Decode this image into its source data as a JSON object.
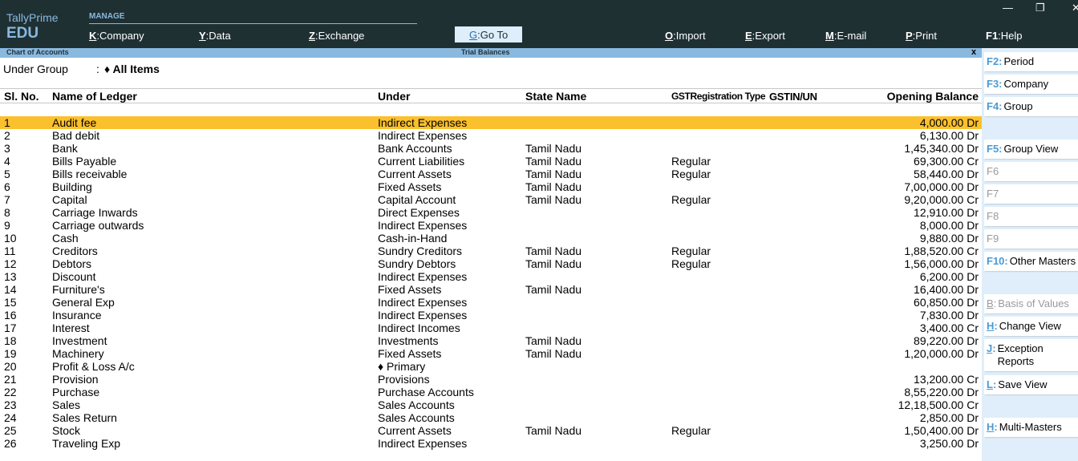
{
  "app": {
    "brand_line1": "TallyPrime",
    "brand_line2": "EDU",
    "section_label": "MANAGE"
  },
  "top_menu": [
    {
      "key": "K",
      "label": "Company"
    },
    {
      "key": "Y",
      "label": "Data"
    },
    {
      "key": "Z",
      "label": "Exchange"
    },
    {
      "key": "G",
      "label": "Go To"
    },
    {
      "key": "O",
      "label": "Import"
    },
    {
      "key": "E",
      "label": "Export"
    },
    {
      "key": "M",
      "label": "E-mail"
    },
    {
      "key": "P",
      "label": "Print"
    },
    {
      "key": "F1",
      "label": "Help"
    }
  ],
  "window_controls": {
    "minimize": "—",
    "restore": "❐",
    "close": "✕"
  },
  "titlebar": {
    "left": "Chart of Accounts",
    "center": "Trial Balances",
    "close": "x"
  },
  "filter": {
    "label": "Under Group",
    "colon": ":",
    "value": "♦ All Items"
  },
  "table": {
    "headers": {
      "sl_no": "Sl. No.",
      "name": "Name of Ledger",
      "under": "Under",
      "state": "State Name",
      "gst_type": "GSTRegistration Type",
      "gstin": "GSTIN/UN",
      "balance": "Opening Balance"
    },
    "rows": [
      {
        "sl": "1",
        "name": "Audit fee",
        "under": "Indirect Expenses",
        "state": "",
        "gst": "",
        "balance": "4,000.00 Dr"
      },
      {
        "sl": "2",
        "name": "Bad debit",
        "under": "Indirect Expenses",
        "state": "",
        "gst": "",
        "balance": "6,130.00 Dr"
      },
      {
        "sl": "3",
        "name": "Bank",
        "under": "Bank Accounts",
        "state": "Tamil Nadu",
        "gst": "",
        "balance": "1,45,340.00 Dr"
      },
      {
        "sl": "4",
        "name": "Bills Payable",
        "under": "Current Liabilities",
        "state": "Tamil Nadu",
        "gst": "Regular",
        "balance": "69,300.00 Cr"
      },
      {
        "sl": "5",
        "name": "Bills receivable",
        "under": "Current Assets",
        "state": "Tamil Nadu",
        "gst": "Regular",
        "balance": "58,440.00 Dr"
      },
      {
        "sl": "6",
        "name": "Building",
        "under": "Fixed Assets",
        "state": "Tamil Nadu",
        "gst": "",
        "balance": "7,00,000.00 Dr"
      },
      {
        "sl": "7",
        "name": "Capital",
        "under": "Capital Account",
        "state": "Tamil Nadu",
        "gst": "Regular",
        "balance": "9,20,000.00 Cr"
      },
      {
        "sl": "8",
        "name": "Carriage Inwards",
        "under": "Direct Expenses",
        "state": "",
        "gst": "",
        "balance": "12,910.00 Dr"
      },
      {
        "sl": "9",
        "name": "Carriage outwards",
        "under": "Indirect Expenses",
        "state": "",
        "gst": "",
        "balance": "8,000.00 Dr"
      },
      {
        "sl": "10",
        "name": "Cash",
        "under": "Cash-in-Hand",
        "state": "",
        "gst": "",
        "balance": "9,880.00 Dr"
      },
      {
        "sl": "11",
        "name": "Creditors",
        "under": "Sundry Creditors",
        "state": "Tamil Nadu",
        "gst": "Regular",
        "balance": "1,88,520.00 Cr"
      },
      {
        "sl": "12",
        "name": "Debtors",
        "under": "Sundry Debtors",
        "state": "Tamil Nadu",
        "gst": "Regular",
        "balance": "1,56,000.00 Dr"
      },
      {
        "sl": "13",
        "name": "Discount",
        "under": "Indirect Expenses",
        "state": "",
        "gst": "",
        "balance": "6,200.00 Dr"
      },
      {
        "sl": "14",
        "name": "Furniture's",
        "under": "Fixed Assets",
        "state": "Tamil Nadu",
        "gst": "",
        "balance": "16,400.00 Dr"
      },
      {
        "sl": "15",
        "name": "General Exp",
        "under": "Indirect Expenses",
        "state": "",
        "gst": "",
        "balance": "60,850.00 Dr"
      },
      {
        "sl": "16",
        "name": "Insurance",
        "under": "Indirect Expenses",
        "state": "",
        "gst": "",
        "balance": "7,830.00 Dr"
      },
      {
        "sl": "17",
        "name": "Interest",
        "under": "Indirect Incomes",
        "state": "",
        "gst": "",
        "balance": "3,400.00 Cr"
      },
      {
        "sl": "18",
        "name": "Investment",
        "under": "Investments",
        "state": "Tamil Nadu",
        "gst": "",
        "balance": "89,220.00 Dr"
      },
      {
        "sl": "19",
        "name": "Machinery",
        "under": "Fixed Assets",
        "state": "Tamil Nadu",
        "gst": "",
        "balance": "1,20,000.00 Dr"
      },
      {
        "sl": "20",
        "name": "Profit & Loss A/c",
        "under": "♦ Primary",
        "state": "",
        "gst": "",
        "balance": ""
      },
      {
        "sl": "21",
        "name": "Provision",
        "under": "Provisions",
        "state": "",
        "gst": "",
        "balance": "13,200.00 Cr"
      },
      {
        "sl": "22",
        "name": "Purchase",
        "under": "Purchase Accounts",
        "state": "",
        "gst": "",
        "balance": "8,55,220.00 Dr"
      },
      {
        "sl": "23",
        "name": "Sales",
        "under": "Sales Accounts",
        "state": "",
        "gst": "",
        "balance": "12,18,500.00 Cr"
      },
      {
        "sl": "24",
        "name": "Sales Return",
        "under": "Sales Accounts",
        "state": "",
        "gst": "",
        "balance": "2,850.00 Dr"
      },
      {
        "sl": "25",
        "name": "Stock",
        "under": "Current Assets",
        "state": "Tamil Nadu",
        "gst": "Regular",
        "balance": "1,50,400.00 Dr"
      },
      {
        "sl": "26",
        "name": "Traveling Exp",
        "under": "Indirect Expenses",
        "state": "",
        "gst": "",
        "balance": "3,250.00 Dr"
      }
    ],
    "selected_row": 0
  },
  "sidebar": [
    {
      "key": "F2",
      "label": "Period",
      "enabled": true
    },
    {
      "key": "F3",
      "label": "Company",
      "enabled": true
    },
    {
      "key": "F4",
      "label": "Group",
      "enabled": true
    },
    {
      "key": "F5",
      "label": "Group View",
      "enabled": true
    },
    {
      "key": "F6",
      "label": "",
      "enabled": false
    },
    {
      "key": "F7",
      "label": "",
      "enabled": false
    },
    {
      "key": "F8",
      "label": "",
      "enabled": false
    },
    {
      "key": "F9",
      "label": "",
      "enabled": false
    },
    {
      "key": "F10",
      "label": "Other Masters",
      "enabled": true
    },
    {
      "key": "B",
      "label": "Basis of Values",
      "enabled": false
    },
    {
      "key": "H",
      "label": "Change View",
      "enabled": true
    },
    {
      "key": "J",
      "label": "Exception Reports",
      "enabled": true
    },
    {
      "key": "L",
      "label": "Save View",
      "enabled": true
    },
    {
      "key": "H",
      "label": "Multi-Masters",
      "enabled": true
    }
  ],
  "colors": {
    "topbar": "#1f3033",
    "accent": "#8ab9e0",
    "selected_row": "#fbc02d",
    "sidebar_bg": "#dfeefa",
    "key_blue": "#4a9ad4"
  }
}
